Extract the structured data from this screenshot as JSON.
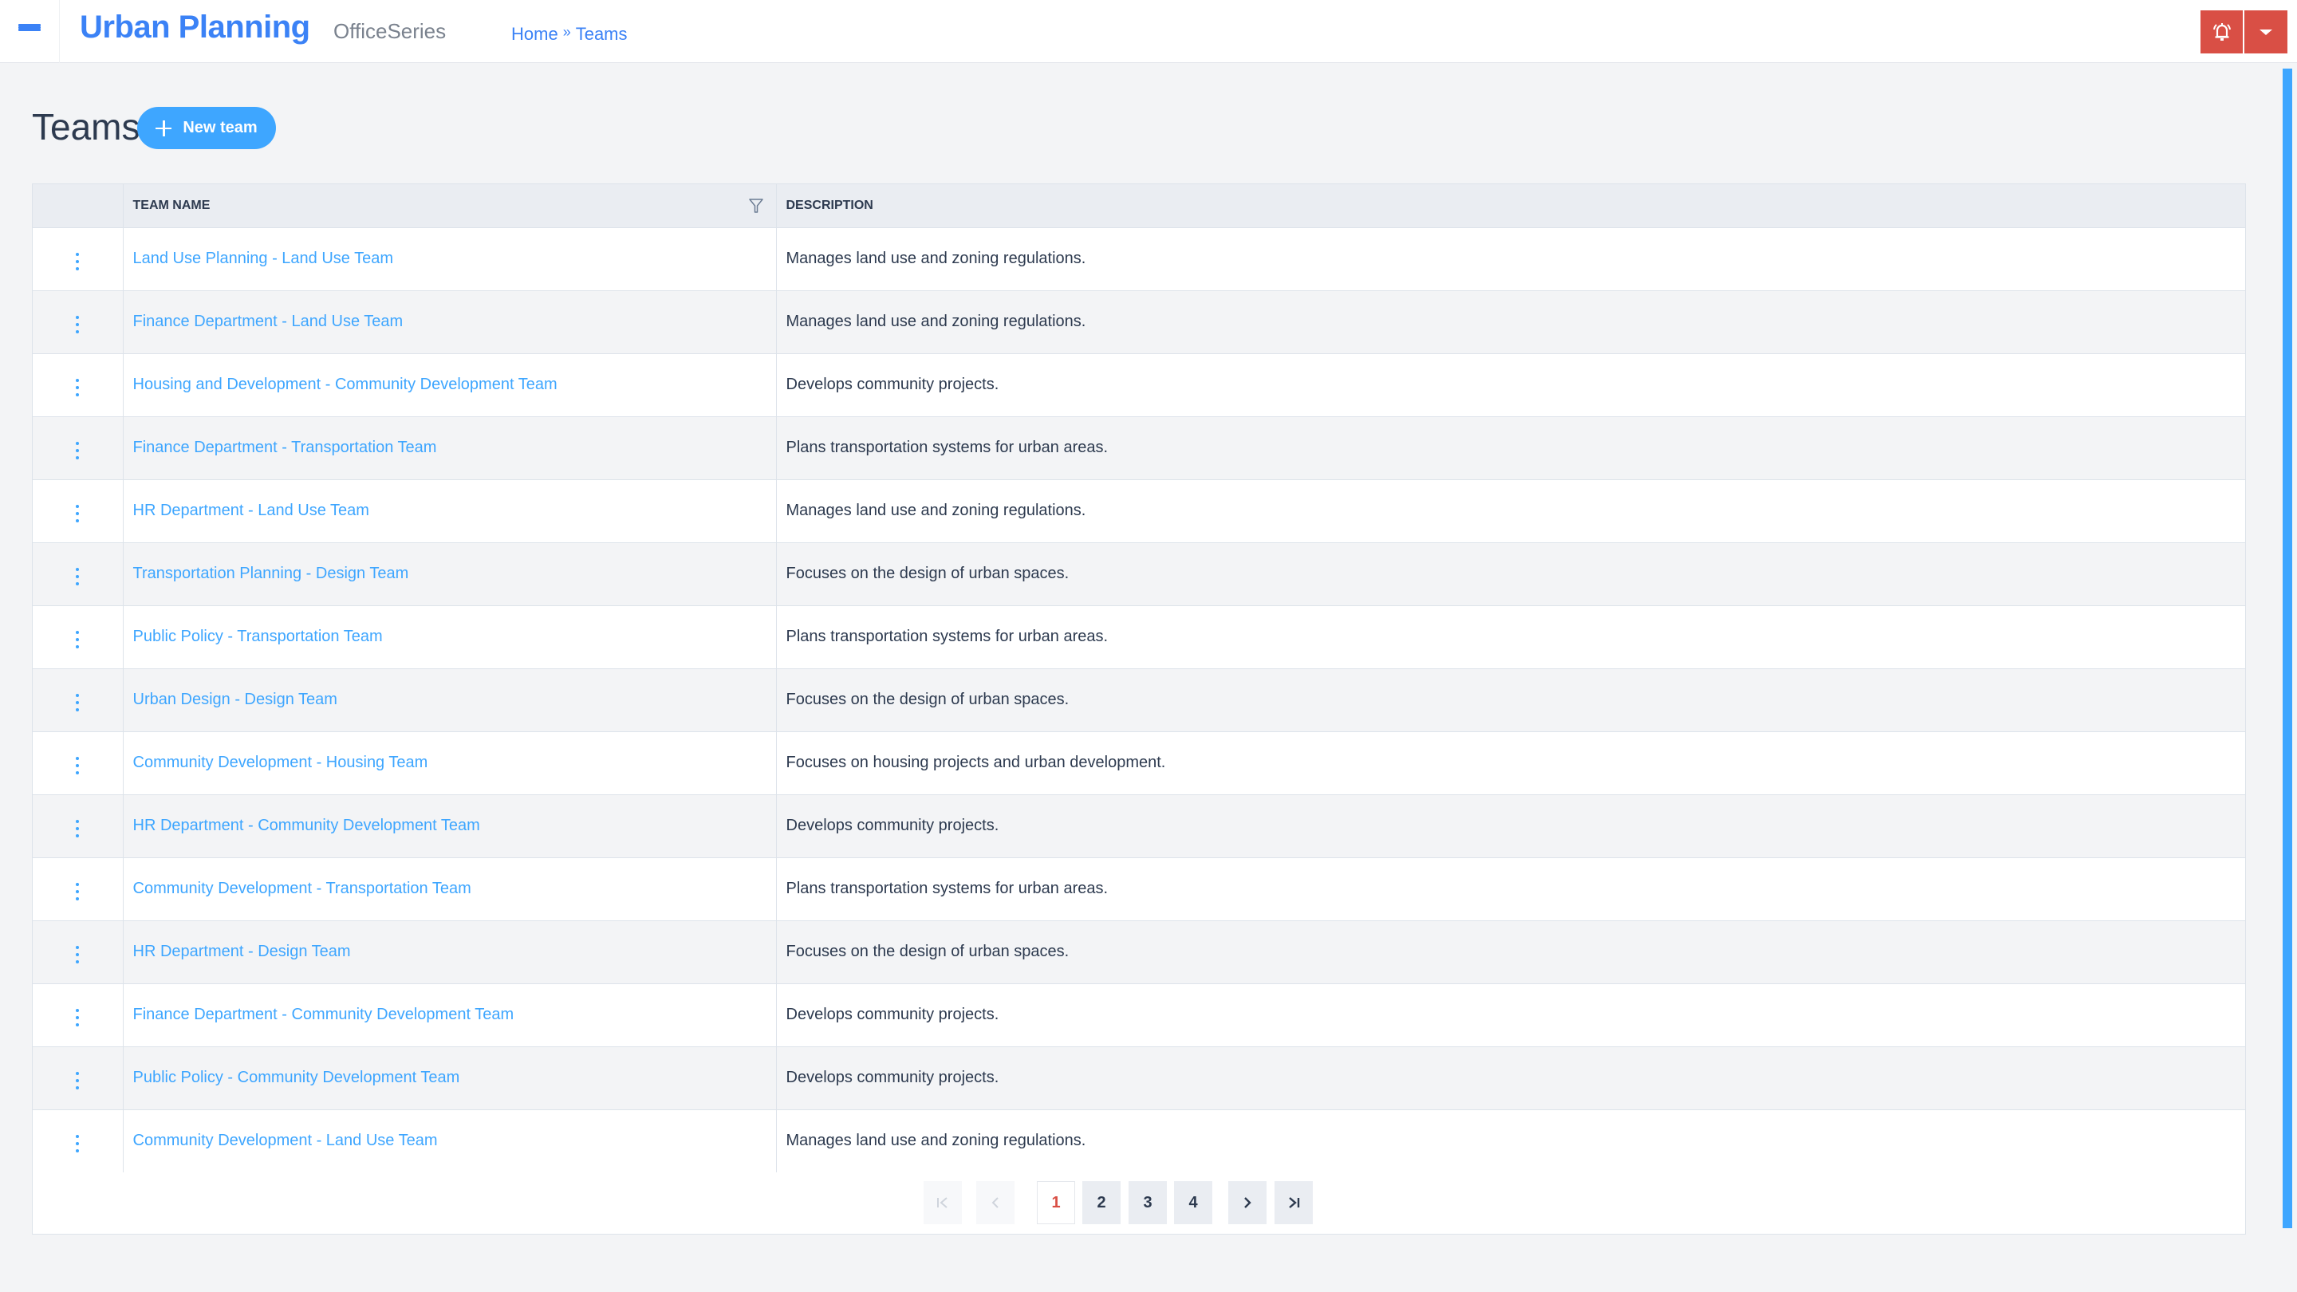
{
  "header": {
    "app_title": "Urban Planning",
    "app_subtitle": "OfficeSeries",
    "breadcrumb": {
      "home": "Home",
      "separator": "»",
      "current": "Teams"
    },
    "alert_icon": "bell-alert-icon",
    "dropdown_icon": "caret-down-icon",
    "accent_color": "#d94f45"
  },
  "page": {
    "title": "Teams",
    "new_button_label": "New team"
  },
  "table": {
    "columns": [
      "",
      "Team Name",
      "Description"
    ],
    "rows": [
      {
        "name": "Land Use Planning - Land Use Team",
        "description": "Manages land use and zoning regulations."
      },
      {
        "name": "Finance Department - Land Use Team",
        "description": "Manages land use and zoning regulations."
      },
      {
        "name": "Housing and Development - Community Development Team",
        "description": "Develops community projects."
      },
      {
        "name": "Finance Department - Transportation Team",
        "description": "Plans transportation systems for urban areas."
      },
      {
        "name": "HR Department - Land Use Team",
        "description": "Manages land use and zoning regulations."
      },
      {
        "name": "Transportation Planning - Design Team",
        "description": "Focuses on the design of urban spaces."
      },
      {
        "name": "Public Policy - Transportation Team",
        "description": "Plans transportation systems for urban areas."
      },
      {
        "name": "Urban Design - Design Team",
        "description": "Focuses on the design of urban spaces."
      },
      {
        "name": "Community Development - Housing Team",
        "description": "Focuses on housing projects and urban development."
      },
      {
        "name": "HR Department - Community Development Team",
        "description": "Develops community projects."
      },
      {
        "name": "Community Development - Transportation Team",
        "description": "Plans transportation systems for urban areas."
      },
      {
        "name": "HR Department - Design Team",
        "description": "Focuses on the design of urban spaces."
      },
      {
        "name": "Finance Department - Community Development Team",
        "description": "Develops community projects."
      },
      {
        "name": "Public Policy - Community Development Team",
        "description": "Develops community projects."
      },
      {
        "name": "Community Development - Land Use Team",
        "description": "Manages land use and zoning regulations."
      }
    ]
  },
  "pagination": {
    "first": "|<",
    "prev": "<",
    "pages": [
      "1",
      "2",
      "3",
      "4"
    ],
    "current_page": "1",
    "next": ">",
    "last": ">|"
  }
}
